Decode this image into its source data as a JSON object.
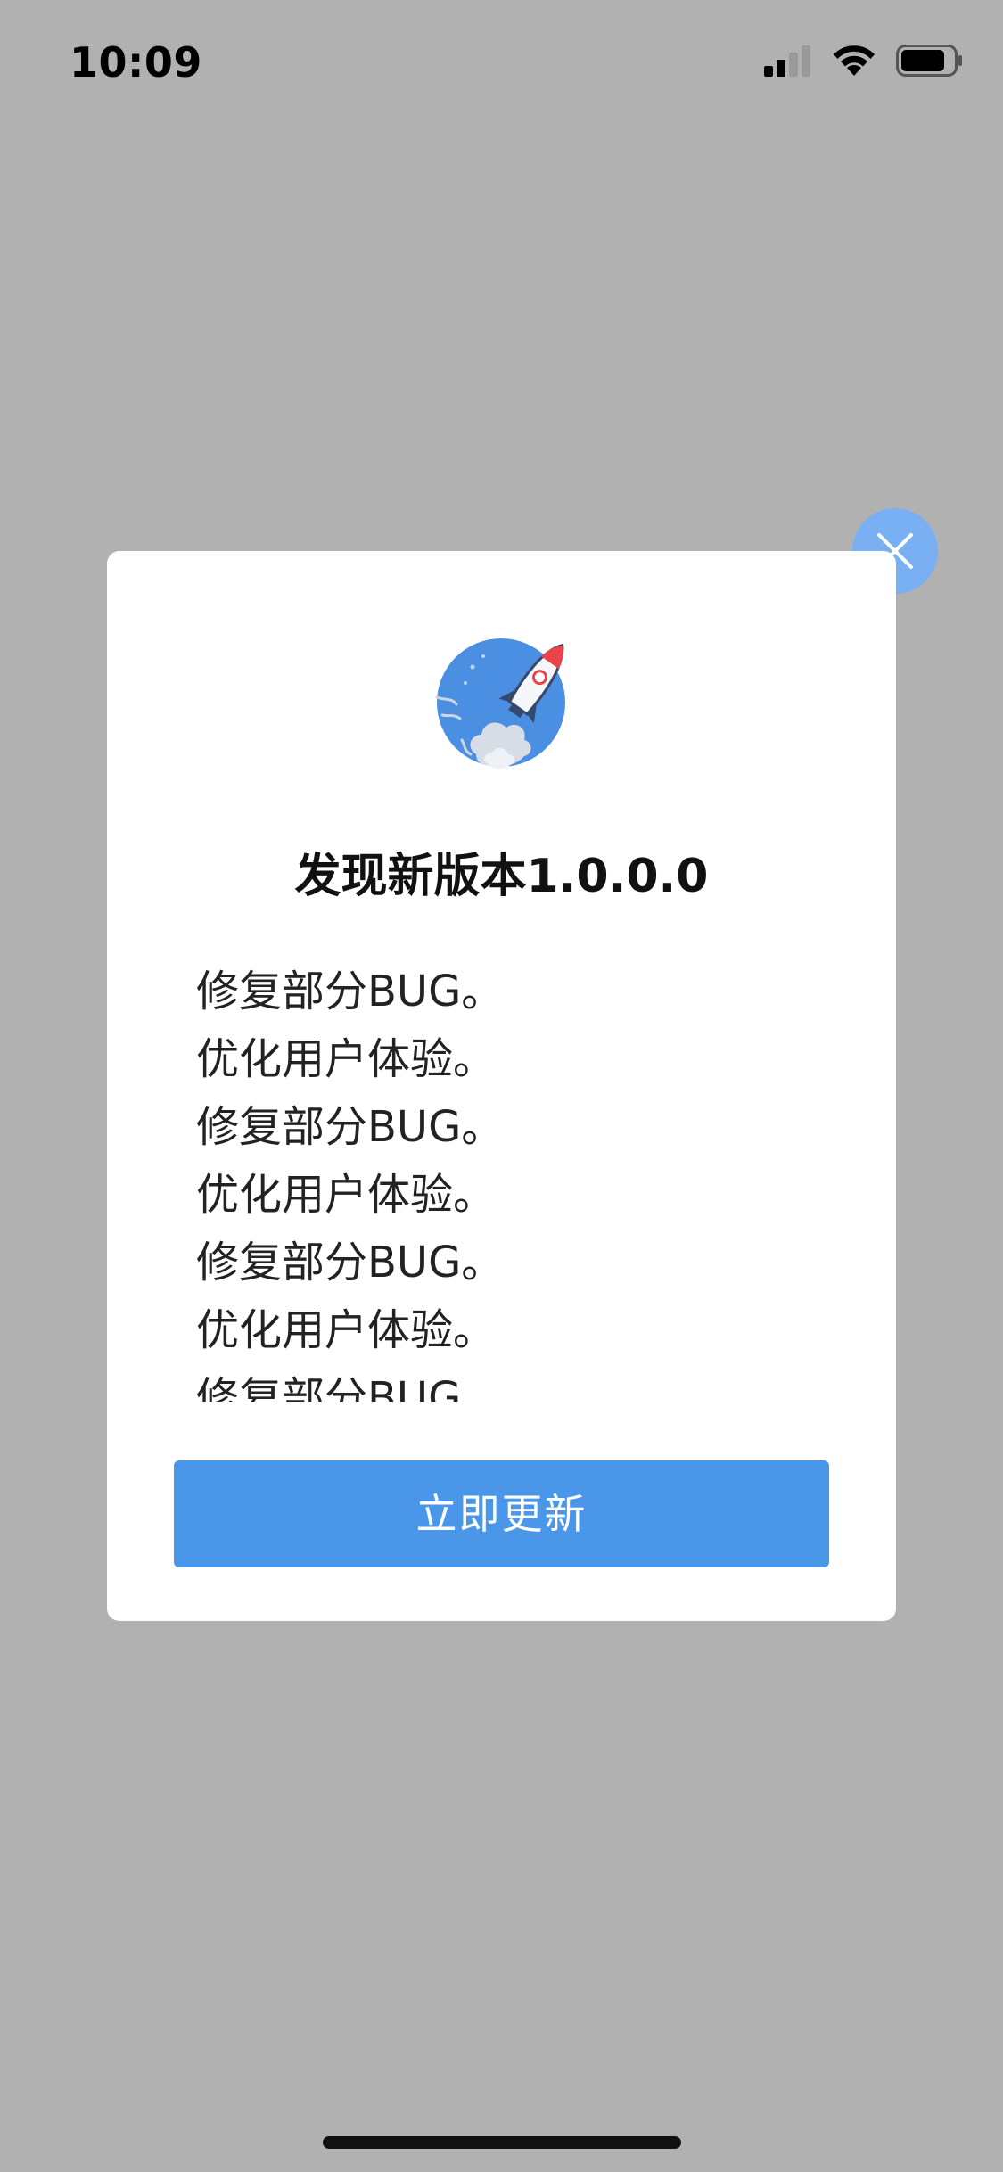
{
  "status_bar": {
    "time": "10:09",
    "icons": [
      "signal-icon",
      "wifi-icon",
      "battery-icon"
    ]
  },
  "dialog": {
    "close_icon": "close-icon",
    "illustration": "rocket-icon",
    "title": "发现新版本1.0.0.0",
    "release_notes": [
      "修复部分BUG。",
      "优化用户体验。",
      "修复部分BUG。",
      "优化用户体验。",
      "修复部分BUG。",
      "优化用户体验。",
      "修复部分BUG。"
    ],
    "update_button_label": "立即更新"
  },
  "colors": {
    "overlay": "#b1b1b1",
    "accent": "#4a96e8",
    "close_button": "#79b0f3"
  }
}
